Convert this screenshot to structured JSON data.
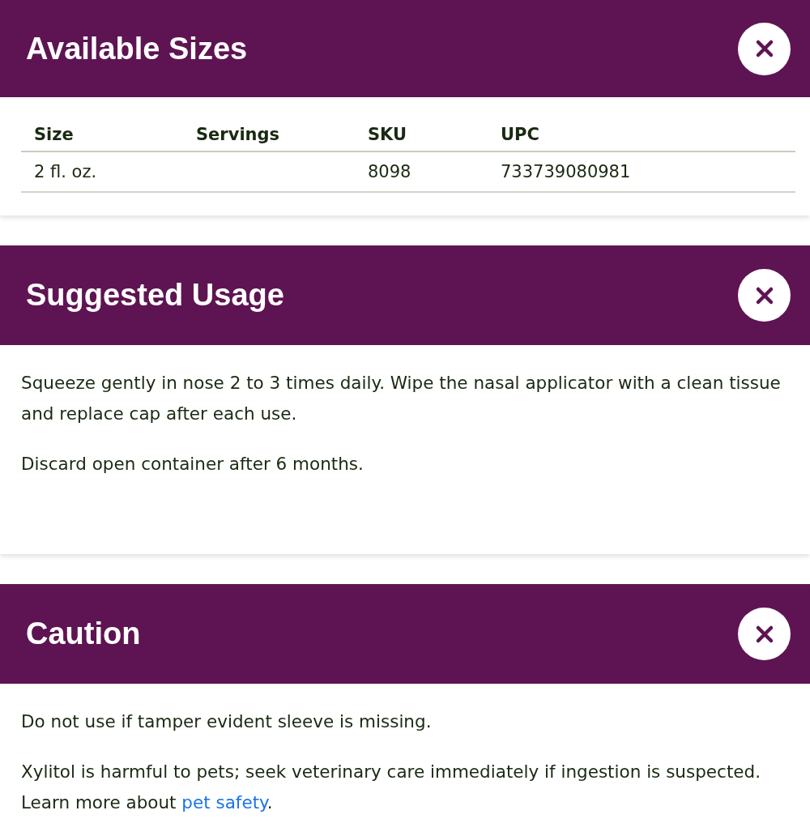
{
  "panels": [
    {
      "title": "Available Sizes",
      "kind": "table",
      "columns": [
        "Size",
        "Servings",
        "SKU",
        "UPC"
      ],
      "rows": [
        [
          "2 fl. oz.",
          "",
          "8098",
          "733739080981"
        ]
      ]
    },
    {
      "title": "Suggested Usage",
      "kind": "text",
      "paragraphs": [
        {
          "text": "Squeeze gently in nose 2 to 3 times daily. Wipe the nasal applicator with a clean tissue and replace cap after each use."
        },
        {
          "text": "Discard open container after 6 months."
        }
      ]
    },
    {
      "title": "Caution",
      "kind": "text",
      "paragraphs": [
        {
          "text": "Do not use if tamper evident sleeve is missing."
        },
        {
          "text": "Xylitol is harmful to pets; seek veterinary care immediately if ingestion is suspected. Learn more about ",
          "link": "pet safety",
          "after": "."
        }
      ]
    }
  ]
}
